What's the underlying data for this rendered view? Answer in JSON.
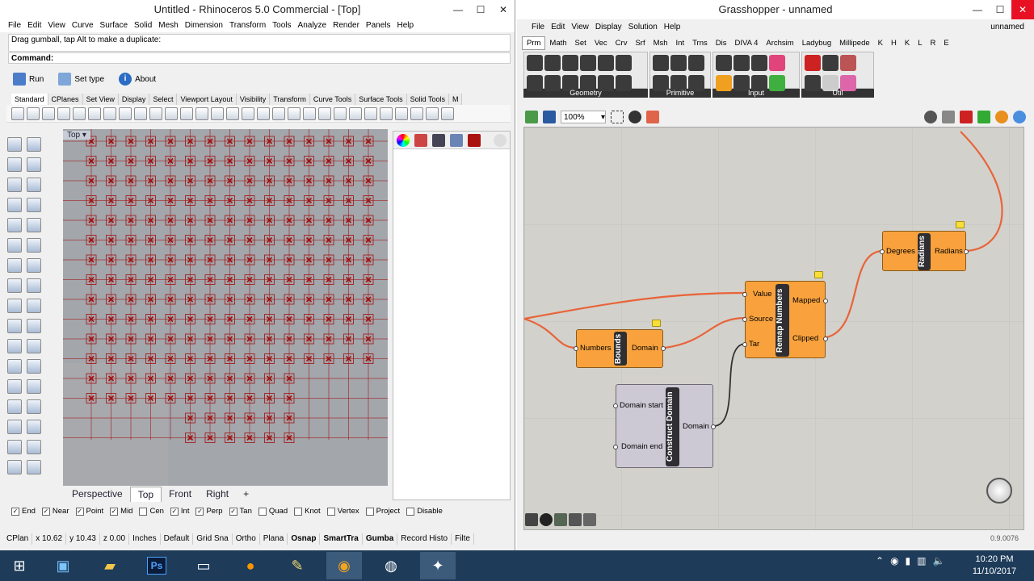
{
  "rhino": {
    "title": "Untitled - Rhinoceros 5.0 Commercial - [Top]",
    "menu": [
      "File",
      "Edit",
      "View",
      "Curve",
      "Surface",
      "Solid",
      "Mesh",
      "Dimension",
      "Transform",
      "Tools",
      "Analyze",
      "Render",
      "Panels",
      "Help"
    ],
    "prompt": "Drag gumball, tap Alt to make a duplicate:",
    "command_label": "Command:",
    "buttons": {
      "run": "Run",
      "settype": "Set type",
      "about": "About"
    },
    "tabs": [
      "Standard",
      "CPlanes",
      "Set View",
      "Display",
      "Select",
      "Viewport Layout",
      "Visibility",
      "Transform",
      "Curve Tools",
      "Surface Tools",
      "Solid Tools",
      "M"
    ],
    "viewport_label": "Top",
    "view_tabs": [
      "Perspective",
      "Top",
      "Front",
      "Right",
      "+"
    ],
    "osnaps": [
      {
        "label": "End",
        "checked": "✓"
      },
      {
        "label": "Near",
        "checked": "✓"
      },
      {
        "label": "Point",
        "checked": "✓"
      },
      {
        "label": "Mid",
        "checked": "✓"
      },
      {
        "label": "Cen",
        "checked": ""
      },
      {
        "label": "Int",
        "checked": "✓"
      },
      {
        "label": "Perp",
        "checked": "✓"
      },
      {
        "label": "Tan",
        "checked": "✓"
      },
      {
        "label": "Quad",
        "checked": ""
      },
      {
        "label": "Knot",
        "checked": ""
      },
      {
        "label": "Vertex",
        "checked": ""
      },
      {
        "label": "Project",
        "checked": ""
      },
      {
        "label": "Disable",
        "checked": ""
      }
    ],
    "status": [
      "CPlan",
      "x 10.62",
      "y 10.43",
      "z 0.00",
      "Inches",
      "Default",
      "Grid Sna",
      "Ortho",
      "Plana",
      "Osnap",
      "SmartTra",
      "Gumba",
      "Record Histo",
      "Filte"
    ]
  },
  "gh": {
    "title": "Grasshopper - unnamed",
    "menu": [
      "File",
      "Edit",
      "View",
      "Display",
      "Solution",
      "Help"
    ],
    "doc_name": "unnamed",
    "tabs": [
      "Prm",
      "Math",
      "Set",
      "Vec",
      "Crv",
      "Srf",
      "Msh",
      "Int",
      "Trns",
      "Dis",
      "DIVA 4",
      "Archsim",
      "Ladybug",
      "Millipede",
      "K",
      "H",
      "K",
      "L",
      "R",
      "E"
    ],
    "sections": [
      "Geometry",
      "Primitive",
      "Input",
      "Util"
    ],
    "zoom": "100%",
    "version": "0.9.0076",
    "components": {
      "bounds": {
        "name": "Bounds",
        "in": "Numbers",
        "out": "Domain"
      },
      "remap": {
        "name": "Remap Numbers",
        "in1": "Value",
        "in2": "Source",
        "in3": "Tar",
        "out1": "Mapped",
        "out2": "Clipped"
      },
      "radians": {
        "name": "Radians",
        "in": "Degrees",
        "out": "Radians"
      },
      "construct": {
        "name": "Construct Domain",
        "in1": "Domain start",
        "in2": "Domain end",
        "out": "Domain"
      }
    }
  },
  "taskbar": {
    "time": "10:20 PM",
    "date": "11/10/2017"
  },
  "colors": {
    "orange": "#f9a23d",
    "grid_red": "#a01010",
    "wire": "#e8643a"
  }
}
